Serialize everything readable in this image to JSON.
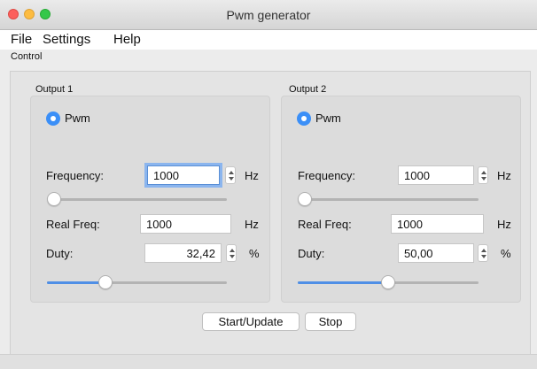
{
  "window": {
    "title": "Pwm generator"
  },
  "menu": {
    "file": "File",
    "settings": "Settings",
    "help": "Help"
  },
  "control_label": "Control",
  "buttons": {
    "start": "Start/Update",
    "stop": "Stop"
  },
  "outputs": [
    {
      "title": "Output 1",
      "mode": "Pwm",
      "frequency_label": "Frequency:",
      "frequency": "1000",
      "frequency_unit": "Hz",
      "frequency_slider": 0.0,
      "real_freq_label": "Real Freq:",
      "real_freq": "1000",
      "real_freq_unit": "Hz",
      "duty_label": "Duty:",
      "duty": "32,42",
      "duty_unit": "%",
      "duty_slider": 0.3242
    },
    {
      "title": "Output 2",
      "mode": "Pwm",
      "frequency_label": "Frequency:",
      "frequency": "1000",
      "frequency_unit": "Hz",
      "frequency_slider": 0.0,
      "real_freq_label": "Real Freq:",
      "real_freq": "1000",
      "real_freq_unit": "Hz",
      "duty_label": "Duty:",
      "duty": "50,00",
      "duty_unit": "%",
      "duty_slider": 0.5
    }
  ]
}
